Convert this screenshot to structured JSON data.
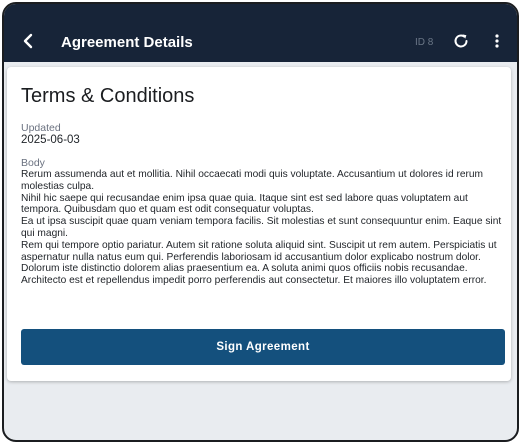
{
  "app_bar": {
    "title": "Agreement Details",
    "id_label": "ID 8",
    "icons": {
      "back": "arrow-left-icon",
      "refresh": "refresh-icon",
      "more": "more-vertical-icon"
    },
    "background": "#172438"
  },
  "document": {
    "title": "Terms & Conditions",
    "updated_label": "Updated",
    "updated_value": "2025-06-03",
    "body_label": "Body",
    "body_paragraphs": [
      "Rerum assumenda aut et mollitia. Nihil occaecati modi quis voluptate. Accusantium ut dolores id rerum molestias culpa.",
      "Nihil hic saepe qui recusandae enim ipsa quae quia. Itaque sint est sed labore quas voluptatem aut tempora. Quibusdam quo et quam est odit consequatur voluptas.",
      "Ea ut ipsa suscipit quae quam veniam tempora facilis. Sit molestias et sunt consequuntur enim. Eaque sint qui magni.",
      "Rem qui tempore optio pariatur. Autem sit ratione soluta aliquid sint. Suscipit ut rem autem. Perspiciatis ut aspernatur nulla natus eum qui. Perferendis laboriosam id accusantium dolor explicabo nostrum dolor.",
      "Dolorum iste distinctio dolorem alias praesentium ea. A soluta animi quos officiis nobis recusandae. Architecto est et repellendus impedit porro perferendis aut consectetur. Et maiores illo voluptatem error."
    ]
  },
  "actions": {
    "sign_label": "Sign Agreement",
    "sign_color": "#14507d"
  }
}
